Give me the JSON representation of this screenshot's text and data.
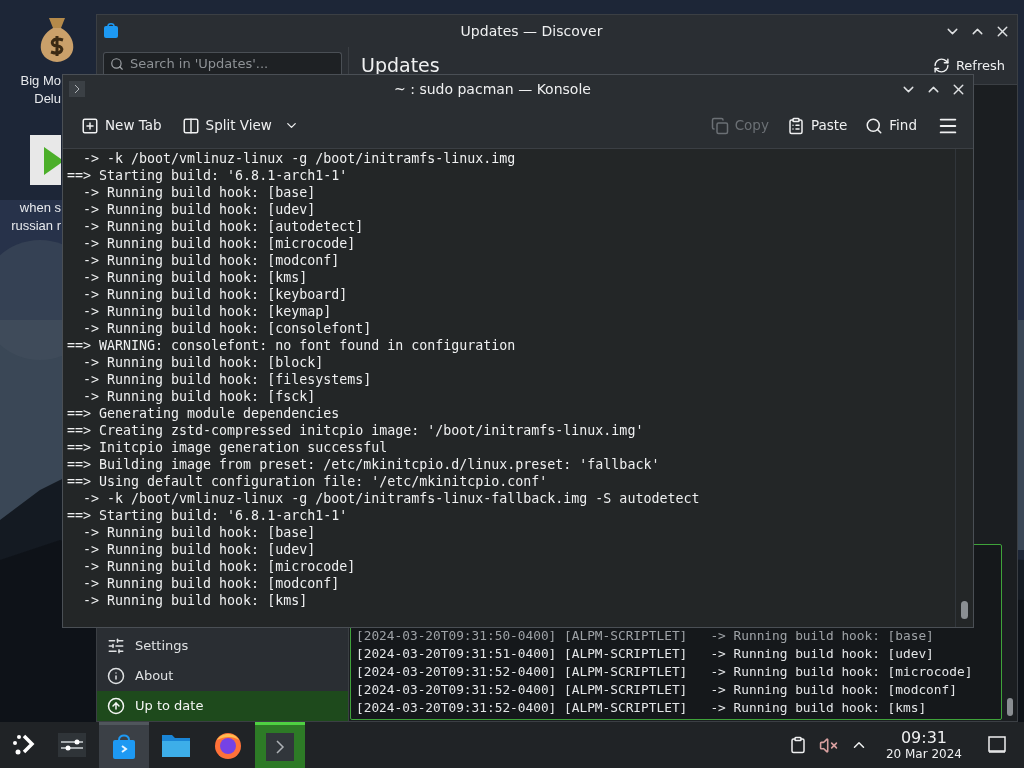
{
  "desktop": {
    "icons": [
      {
        "kind": "money-bag",
        "label_lines": [
          "Big Mo",
          "Delu"
        ]
      },
      {
        "kind": "video",
        "label_lines": [
          "when s",
          "russian r"
        ]
      }
    ]
  },
  "discover": {
    "title": "Updates — Discover",
    "search": {
      "placeholder": "Search in 'Updates'..."
    },
    "heading": "Updates",
    "refresh": "Refresh",
    "sidebar": {
      "items": [
        {
          "kind": "settings",
          "label": "Settings",
          "selected": false
        },
        {
          "kind": "about",
          "label": "About",
          "selected": false
        },
        {
          "kind": "update",
          "label": "Up to date",
          "selected": true
        }
      ]
    },
    "log": [
      "[2024-03-20T09:31:50-0400] [ALPM-SCRIPTLET]   -> Running build hook: [base]",
      "[2024-03-20T09:31:51-0400] [ALPM-SCRIPTLET]   -> Running build hook: [udev]",
      "[2024-03-20T09:31:52-0400] [ALPM-SCRIPTLET]   -> Running build hook: [microcode]",
      "[2024-03-20T09:31:52-0400] [ALPM-SCRIPTLET]   -> Running build hook: [modconf]",
      "[2024-03-20T09:31:52-0400] [ALPM-SCRIPTLET]   -> Running build hook: [kms]"
    ]
  },
  "konsole": {
    "title": "~ : sudo pacman — Konsole",
    "toolbar_left": [
      {
        "kind": "new-tab",
        "label": "New Tab",
        "disabled": false
      },
      {
        "kind": "split",
        "label": "Split View",
        "disabled": false
      }
    ],
    "toolbar_right": [
      {
        "kind": "copy",
        "label": "Copy",
        "disabled": true
      },
      {
        "kind": "paste",
        "label": "Paste",
        "disabled": false
      },
      {
        "kind": "find",
        "label": "Find",
        "disabled": false
      }
    ],
    "lines": [
      "  -> -k /boot/vmlinuz-linux -g /boot/initramfs-linux.img",
      "==> Starting build: '6.8.1-arch1-1'",
      "  -> Running build hook: [base]",
      "  -> Running build hook: [udev]",
      "  -> Running build hook: [autodetect]",
      "  -> Running build hook: [microcode]",
      "  -> Running build hook: [modconf]",
      "  -> Running build hook: [kms]",
      "  -> Running build hook: [keyboard]",
      "  -> Running build hook: [keymap]",
      "  -> Running build hook: [consolefont]",
      "==> WARNING: consolefont: no font found in configuration",
      "  -> Running build hook: [block]",
      "  -> Running build hook: [filesystems]",
      "  -> Running build hook: [fsck]",
      "==> Generating module dependencies",
      "==> Creating zstd-compressed initcpio image: '/boot/initramfs-linux.img'",
      "==> Initcpio image generation successful",
      "==> Building image from preset: /etc/mkinitcpio.d/linux.preset: 'fallback'",
      "==> Using default configuration file: '/etc/mkinitcpio.conf'",
      "  -> -k /boot/vmlinuz-linux -g /boot/initramfs-linux-fallback.img -S autodetect",
      "==> Starting build: '6.8.1-arch1-1'",
      "  -> Running build hook: [base]",
      "  -> Running build hook: [udev]",
      "  -> Running build hook: [microcode]",
      "  -> Running build hook: [modconf]",
      "  -> Running build hook: [kms]"
    ]
  },
  "taskbar": {
    "tasks": [
      {
        "kind": "mixer",
        "running": false,
        "focused": false
      },
      {
        "kind": "store",
        "running": true,
        "focused": false
      },
      {
        "kind": "files",
        "running": false,
        "focused": false
      },
      {
        "kind": "browser",
        "running": false,
        "focused": false
      },
      {
        "kind": "terminal",
        "running": true,
        "focused": true
      }
    ],
    "tray": {
      "muted": true
    },
    "clock": {
      "time": "09:31",
      "date": "20 Mar 2024"
    }
  }
}
